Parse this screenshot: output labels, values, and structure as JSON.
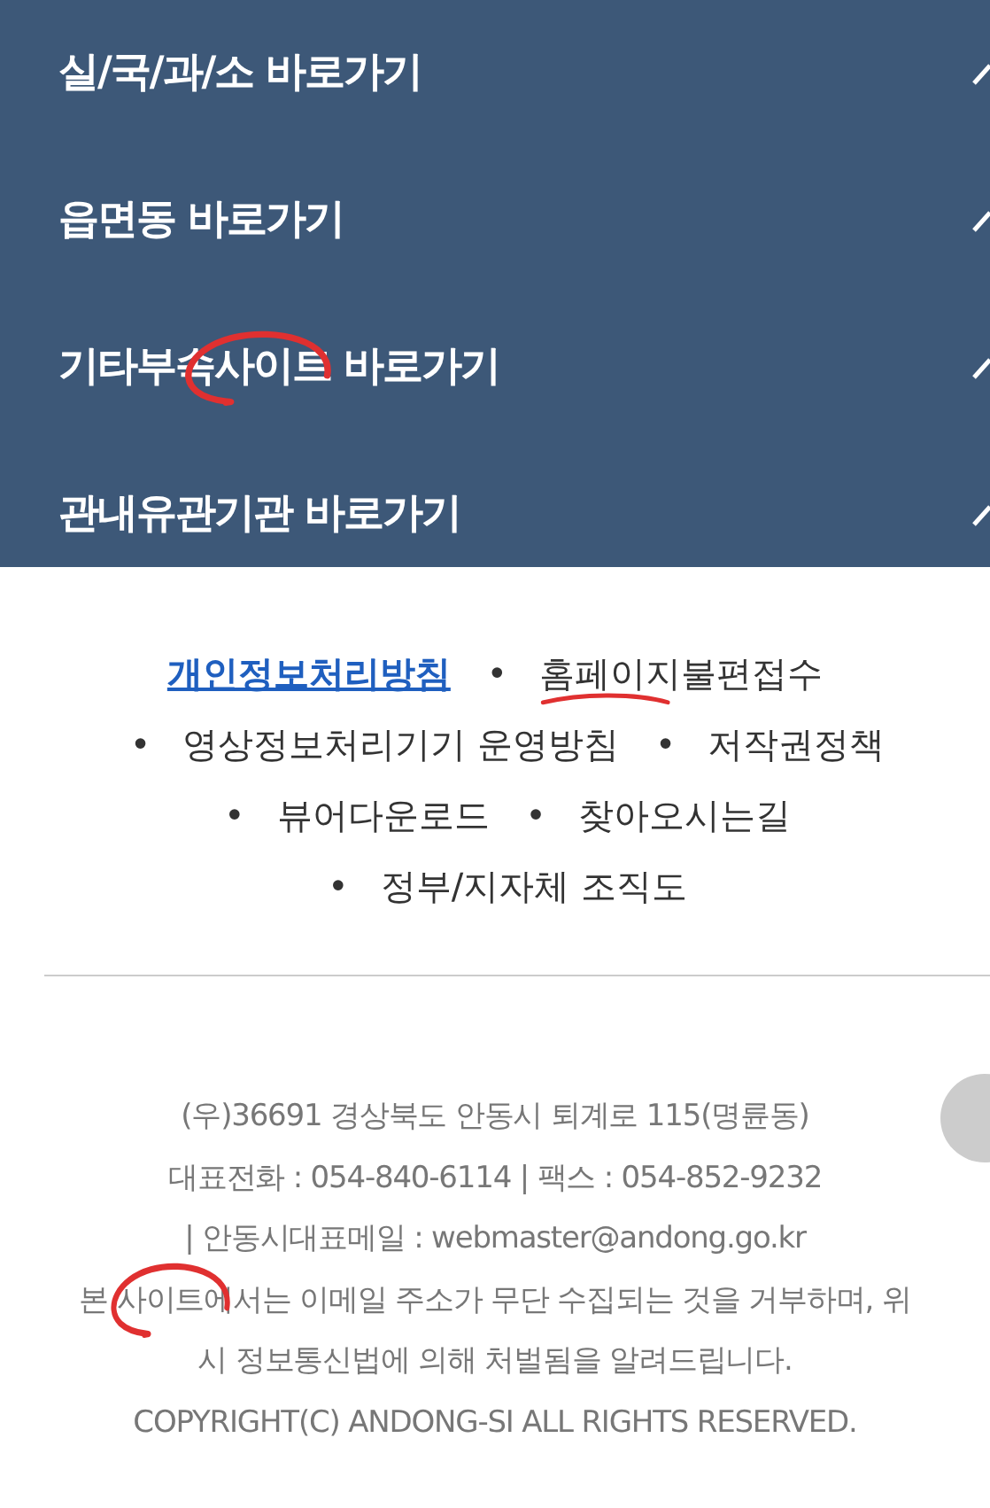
{
  "menu": [
    {
      "label": "실/국/과/소 바로가기",
      "circled": false
    },
    {
      "label": "읍면동 바로가기",
      "circled": false
    },
    {
      "label": "기타부속사이트 바로가기",
      "circled": true
    },
    {
      "label": "관내유관기관 바로가기",
      "circled": false
    }
  ],
  "links": [
    {
      "label": "개인정보처리방침",
      "highlighted": true,
      "underlined": false
    },
    {
      "label": "홈페이지불편접수",
      "highlighted": false,
      "bullet": "•",
      "underlined": true
    },
    {
      "label": "영상정보처리기기 운영방침",
      "highlighted": false,
      "bullet": "•",
      "underlined": false
    },
    {
      "label": "저작권정책",
      "highlighted": false,
      "bullet": "•",
      "underlined": false
    },
    {
      "label": "뷰어다운로드",
      "highlighted": false,
      "bullet": "•",
      "underlined": false
    },
    {
      "label": "찾아오시는길",
      "highlighted": false,
      "bullet": "•",
      "underlined": false
    },
    {
      "label": "정부/지자체 조직도",
      "highlighted": false,
      "bullet": "•",
      "underlined": false
    }
  ],
  "footer": [
    {
      "text": "(우)36691 경상북도 안동시 퇴계로 115(명륜동)",
      "circled": false
    },
    {
      "text": "대표전화 : 054-840-6114  | 팩스 : 054-852-9232",
      "circled": false
    },
    {
      "text": "| 안동시대표메일 : webmaster@andong.go.kr",
      "circled": false
    },
    {
      "text": "본 사이트에서는 이메일 주소가 무단 수집되는 것을 거부하며, 위",
      "circled": true
    },
    {
      "text": "시 정보통신법에 의해 처벌됨을 알려드립니다.",
      "circled": false
    },
    {
      "text": "COPYRIGHT(C) ANDONG-SI ALL RIGHTS RESERVED.",
      "circled": false
    }
  ]
}
